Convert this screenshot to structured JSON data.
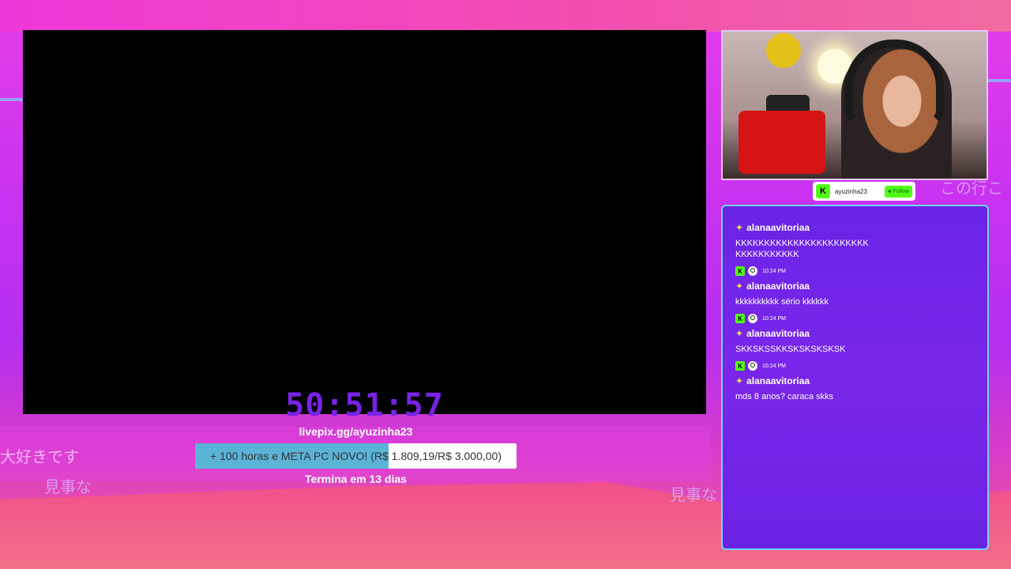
{
  "background": {
    "jp_texts": [
      "大好きです",
      "見事な",
      "見事な",
      "この行こ"
    ],
    "colors": {
      "magenta": "#e63de8",
      "purple": "#b42ff0",
      "pink": "#f25f8a"
    }
  },
  "game": {
    "timer": "50:51:57",
    "timer_color": "#7a22e8"
  },
  "webcam": {
    "follow": {
      "platform_logo": "K",
      "username": "ayuzinha23",
      "button_label": "Follow"
    }
  },
  "chat": {
    "messages": [
      {
        "user": "alanaavitoriaa",
        "text": "KKKKKKKKKKKKKKKKKKKKKKKKKKKKKKKKKK",
        "time": "10:24 PM"
      },
      {
        "user": "alanaavitoriaa",
        "text": "kkkkkkkkkk sério kkkkkk",
        "time": "10:24 PM"
      },
      {
        "user": "alanaavitoriaa",
        "text": "SKKSKSSKKSKSKSKSKSK",
        "time": "10:24 PM"
      },
      {
        "user": "alanaavitoriaa",
        "text": "mds 8 anos? caraca skks"
      }
    ]
  },
  "livepix": {
    "url": "livepix.gg/ayuzinha23",
    "goal_text": "+ 100 horas e META PC NOVO! (R$ 1.809,19/R$ 3.000,00)",
    "goal_progress": 0.603,
    "ends": "Termina em 13 dias"
  }
}
